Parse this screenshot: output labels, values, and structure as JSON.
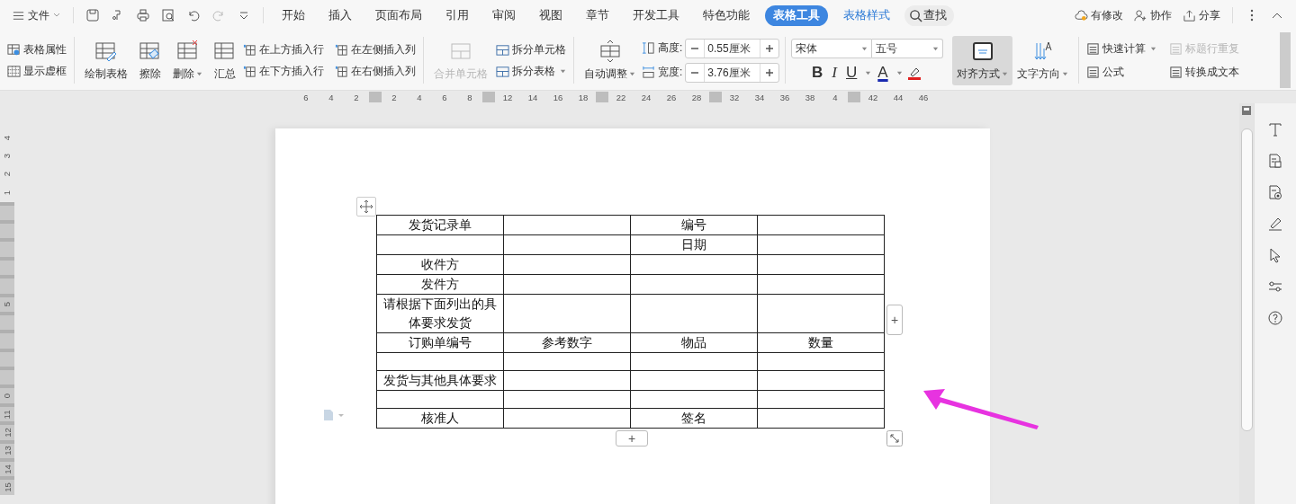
{
  "menu": {
    "file": "文件",
    "tabs": [
      {
        "label": "开始",
        "selected": false
      },
      {
        "label": "插入",
        "selected": false
      },
      {
        "label": "页面布局",
        "selected": false
      },
      {
        "label": "引用",
        "selected": false
      },
      {
        "label": "审阅",
        "selected": false
      },
      {
        "label": "视图",
        "selected": false
      },
      {
        "label": "章节",
        "selected": false
      },
      {
        "label": "开发工具",
        "selected": false
      },
      {
        "label": "特色功能",
        "selected": false
      },
      {
        "label": "表格工具",
        "selected": true
      },
      {
        "label": "表格样式",
        "selected": false
      }
    ],
    "search": "查找",
    "right": [
      "有修改",
      "协作",
      "分享"
    ]
  },
  "ribbon": {
    "props": [
      "表格属性",
      "显示虚框"
    ],
    "large": [
      {
        "label": "绘制表格",
        "disabled": false
      },
      {
        "label": "擦除",
        "disabled": false
      },
      {
        "label": "删除",
        "disabled": false
      },
      {
        "label": "汇总",
        "disabled": false
      }
    ],
    "insert": [
      "在上方插入行",
      "在左侧插入列",
      "在下方插入行",
      "在右侧插入列"
    ],
    "merge": {
      "label": "合并单元格",
      "disabled": true
    },
    "split": [
      "拆分单元格",
      "拆分表格"
    ],
    "auto": "自动调整",
    "height": {
      "label": "高度:",
      "value": "0.55厘米"
    },
    "width": {
      "label": "宽度:",
      "value": "3.76厘米"
    },
    "font": {
      "family": "宋体",
      "size": "五号"
    },
    "format": [
      "B",
      "I",
      "U",
      "A"
    ],
    "align": {
      "label": "对齐方式",
      "selected": true
    },
    "direction": "文字方向",
    "calc": [
      {
        "label": "快速计算",
        "disabled": false
      },
      {
        "label": "标题行重复",
        "disabled": true
      },
      {
        "label": "公式",
        "disabled": false
      },
      {
        "label": "转换成文本",
        "disabled": false
      }
    ]
  },
  "h_ruler": [
    {
      "kind": "num",
      "label": "6"
    },
    {
      "kind": "num",
      "label": "4"
    },
    {
      "kind": "num",
      "label": "2"
    },
    {
      "kind": "block"
    },
    {
      "kind": "num",
      "label": "2"
    },
    {
      "kind": "num",
      "label": "4"
    },
    {
      "kind": "num",
      "label": "6"
    },
    {
      "kind": "num",
      "label": "8"
    },
    {
      "kind": "block"
    },
    {
      "kind": "num",
      "label": "12"
    },
    {
      "kind": "num",
      "label": "14"
    },
    {
      "kind": "num",
      "label": "16"
    },
    {
      "kind": "num",
      "label": "18"
    },
    {
      "kind": "block"
    },
    {
      "kind": "num",
      "label": "22"
    },
    {
      "kind": "num",
      "label": "24"
    },
    {
      "kind": "num",
      "label": "26"
    },
    {
      "kind": "num",
      "label": "28"
    },
    {
      "kind": "block"
    },
    {
      "kind": "num",
      "label": "32"
    },
    {
      "kind": "num",
      "label": "34"
    },
    {
      "kind": "num",
      "label": "36"
    },
    {
      "kind": "num",
      "label": "38"
    },
    {
      "kind": "num",
      "label": "4"
    },
    {
      "kind": "block"
    },
    {
      "kind": "num",
      "label": "42"
    },
    {
      "kind": "num",
      "label": "44"
    },
    {
      "kind": "num",
      "label": "46"
    }
  ],
  "v_ruler": [
    {
      "label": "4",
      "shaded": false
    },
    {
      "label": "3",
      "shaded": false
    },
    {
      "label": "2",
      "shaded": false
    },
    {
      "label": "1",
      "shaded": false
    },
    {
      "shaded": true
    },
    {
      "shaded": true
    },
    {
      "shaded": true
    },
    {
      "shaded": true
    },
    {
      "shaded": true
    },
    {
      "label": "5",
      "shaded": true
    },
    {
      "shaded": true
    },
    {
      "shaded": true
    },
    {
      "shaded": true
    },
    {
      "shaded": true
    },
    {
      "label": "0",
      "shaded": true
    },
    {
      "label": "11",
      "shaded": true
    },
    {
      "label": "12",
      "shaded": true
    },
    {
      "label": "13",
      "shaded": true
    },
    {
      "label": "14",
      "shaded": true
    },
    {
      "label": "15",
      "shaded": true
    }
  ],
  "table": {
    "rows": [
      {
        "column_1": "发货记录单",
        "column_3": "编号"
      },
      {
        "column_3": "日期"
      },
      {
        "column_1": "收件方"
      },
      {
        "column_1": "发件方"
      },
      {
        "column_1": "请根据下面列出的具体要求发货"
      },
      {
        "column_1": "订购单编号",
        "column_2": "参考数字",
        "column_3": "物品",
        "column_4": "数量"
      },
      {},
      {
        "column_1": "发货与其他具体要求"
      },
      {},
      {
        "column_1": "核准人",
        "column_3": "签名"
      }
    ]
  },
  "add_row": "+",
  "add_col": "+"
}
